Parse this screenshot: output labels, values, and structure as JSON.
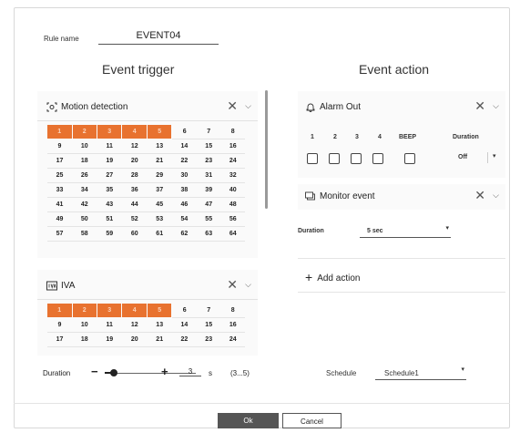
{
  "rule": {
    "label": "Rule name",
    "value": "EVENT04"
  },
  "headings": {
    "trigger": "Event trigger",
    "action": "Event action"
  },
  "motion": {
    "title": "Motion detection",
    "icon": "motion-detection-icon",
    "close": "✕",
    "expand": "⌵",
    "channels": [
      [
        "1",
        "2",
        "3",
        "4",
        "5",
        "6",
        "7",
        "8"
      ],
      [
        "9",
        "10",
        "11",
        "12",
        "13",
        "14",
        "15",
        "16"
      ],
      [
        "17",
        "18",
        "19",
        "20",
        "21",
        "22",
        "23",
        "24"
      ],
      [
        "25",
        "26",
        "27",
        "28",
        "29",
        "30",
        "31",
        "32"
      ],
      [
        "33",
        "34",
        "35",
        "36",
        "37",
        "38",
        "39",
        "40"
      ],
      [
        "41",
        "42",
        "43",
        "44",
        "45",
        "46",
        "47",
        "48"
      ],
      [
        "49",
        "50",
        "51",
        "52",
        "53",
        "54",
        "55",
        "56"
      ],
      [
        "57",
        "58",
        "59",
        "60",
        "61",
        "62",
        "63",
        "64"
      ]
    ],
    "selected": [
      "1",
      "2",
      "3",
      "4",
      "5"
    ]
  },
  "iva": {
    "title": "IVA",
    "icon": "iva-icon",
    "close": "✕",
    "expand": "⌵",
    "channels": [
      [
        "1",
        "2",
        "3",
        "4",
        "5",
        "6",
        "7",
        "8"
      ],
      [
        "9",
        "10",
        "11",
        "12",
        "13",
        "14",
        "15",
        "16"
      ],
      [
        "17",
        "18",
        "19",
        "20",
        "21",
        "22",
        "23",
        "24"
      ]
    ],
    "selected": [
      "1",
      "2",
      "3",
      "4",
      "5"
    ]
  },
  "duration": {
    "label": "Duration",
    "minus": "−",
    "plus": "+",
    "value": "3",
    "unit": "s",
    "range": "(3...5)",
    "min": 3,
    "max": 5,
    "slider_fraction": 0.1
  },
  "alarm": {
    "title": "Alarm Out",
    "icon": "alarm-bell-icon",
    "close": "✕",
    "expand": "⌵",
    "columns": [
      "1",
      "2",
      "3",
      "4",
      "BEEP",
      "Duration"
    ],
    "checked": [
      false,
      false,
      false,
      false,
      false
    ],
    "duration_value": "Off",
    "duration_caret": "▾"
  },
  "monitor": {
    "title": "Monitor event",
    "icon": "monitor-event-icon",
    "close": "✕",
    "expand": "⌵",
    "duration_label": "Duration",
    "duration_value": "5 sec",
    "duration_caret": "▾"
  },
  "add_action": {
    "plus": "+",
    "label": "Add action"
  },
  "schedule": {
    "label": "Schedule",
    "value": "Schedule1",
    "caret": "▾"
  },
  "buttons": {
    "ok": "Ok",
    "cancel": "Cancel"
  },
  "colors": {
    "selected_channel": "#e8722f",
    "ok_button": "#555555"
  }
}
